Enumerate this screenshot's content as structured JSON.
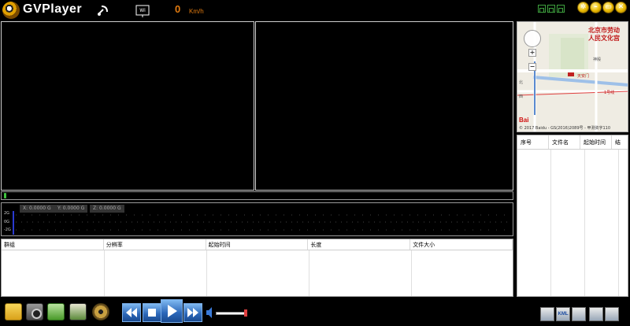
{
  "app": {
    "title": "GVPlayer"
  },
  "status": {
    "speed_value": "0",
    "speed_unit": "Km/h"
  },
  "gsensor": {
    "x_label": "X: 0.0000 G",
    "y_label": "Y: 0.0000 G",
    "z_label": "Z: 0.0000 G",
    "y_axis": [
      "2G",
      "0G",
      "-2G"
    ]
  },
  "file_table": {
    "columns": [
      "群组",
      "分辨率",
      "起始时间",
      "长度",
      "文件大小"
    ],
    "rows": []
  },
  "map": {
    "place_label": "北京市劳动\n人民文化宫",
    "landmark": "天安门",
    "label_west": "西",
    "label_north": "北",
    "label_line": "1号线",
    "label_shenmiao": "神殿",
    "baidu_logo": "Bai",
    "copyright": "© 2017 Baidu - GS(2016)2089号 - 甲测资字110"
  },
  "playlist": {
    "columns": [
      "序号",
      "文件名",
      "起始时间",
      "结"
    ],
    "rows": []
  },
  "toolbar": {
    "kml_label": "KML"
  },
  "colors": {
    "accent_orange": "#e07a10",
    "button_blue": "#2a66b8",
    "window_btn_yellow": "#e8b800"
  }
}
